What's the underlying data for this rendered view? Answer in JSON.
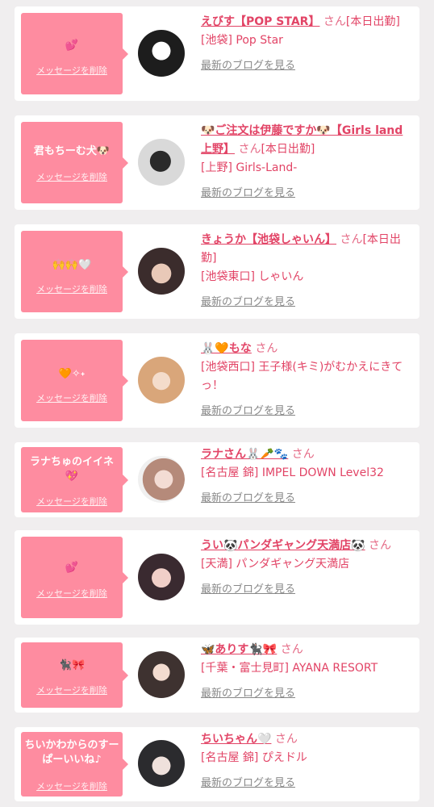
{
  "delete_label": "メッセージを削除",
  "blog_label": "最新のブログを見る",
  "cards": [
    {
      "message": "💕",
      "name": "えびす【POP STAR】",
      "san": "さん",
      "status": "[本日出勤]",
      "shop": "[池袋] Pop Star"
    },
    {
      "message": "君もちーむ犬🐶",
      "name": "🐶ご注文は伊藤ですか🐶【Girls land上野】",
      "san": "さん",
      "status": "[本日出勤]",
      "shop": "[上野] Girls-Land-"
    },
    {
      "message": "🙌🙌🤍",
      "name": "きょうか【池袋しゃいん】",
      "san": "さん",
      "status": "[本日出勤]",
      "shop": "[池袋東口] しゃいん"
    },
    {
      "message": "🧡✧˖",
      "name": "🐰🧡もな",
      "san": "さん",
      "status": "",
      "shop": "[池袋西口] 王子様(キミ)がむかえにきてっ！"
    },
    {
      "message": "ラナちゅのイイネ💖",
      "name": "ラナさん🐰🥕🐾",
      "san": "さん",
      "status": "",
      "shop": "[名古屋 錦] IMPEL DOWN Level32"
    },
    {
      "message": "💕",
      "name": "うい🐼パンダギャング天満店🐼",
      "san": "さん",
      "status": "",
      "shop": "[天満] パンダギャング天満店"
    },
    {
      "message": "🐈‍⬛🎀",
      "name": "🦋ありす🐈‍⬛🎀",
      "san": "さん",
      "status": "",
      "shop": "[千葉・富士見町] AYANA RESORT"
    },
    {
      "message": "ちいかわからのすーぱーいいね♪",
      "name": "ちいちゃん🤍",
      "san": "さん",
      "status": "",
      "shop": "[名古屋 錦] ぴえドル"
    }
  ]
}
